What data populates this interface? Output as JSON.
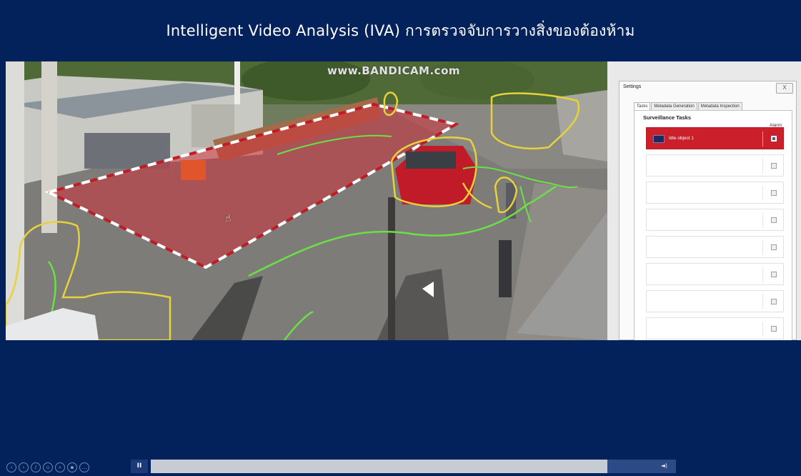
{
  "title": "Intelligent Video Analysis (IVA) การตรวจจับการวางสิ่งของต้องห้าม",
  "video": {
    "watermark": "www.BANDICAM.com"
  },
  "settings": {
    "title": "Settings",
    "close_label": "X",
    "tabs": [
      "Tasks",
      "Metadata Generation",
      "Metadata Inspection"
    ],
    "section_title": "Surveillance Tasks",
    "alarm_header": "Alarm",
    "tasks": [
      {
        "name": "Idle object 1",
        "alarm": true,
        "active": true
      },
      {
        "name": "",
        "alarm": false,
        "active": false
      },
      {
        "name": "",
        "alarm": false,
        "active": false
      },
      {
        "name": "",
        "alarm": false,
        "active": false
      },
      {
        "name": "",
        "alarm": false,
        "active": false
      },
      {
        "name": "",
        "alarm": false,
        "active": false
      },
      {
        "name": "",
        "alarm": false,
        "active": false
      },
      {
        "name": "",
        "alarm": false,
        "active": false
      }
    ]
  },
  "player": {
    "buttons": [
      "previous-icon",
      "next-icon",
      "pen-icon",
      "slides-icon",
      "zoom-icon",
      "grid-icon",
      "more-icon"
    ],
    "pause_label": "II",
    "volume_label": "◄)",
    "progress": 0.87
  },
  "colors": {
    "background": "#03215a",
    "alarm_zone": "#d0313b",
    "detection_outline": "#e6d23a",
    "track_line": "#6be044",
    "active_task": "#cc1f2c"
  }
}
